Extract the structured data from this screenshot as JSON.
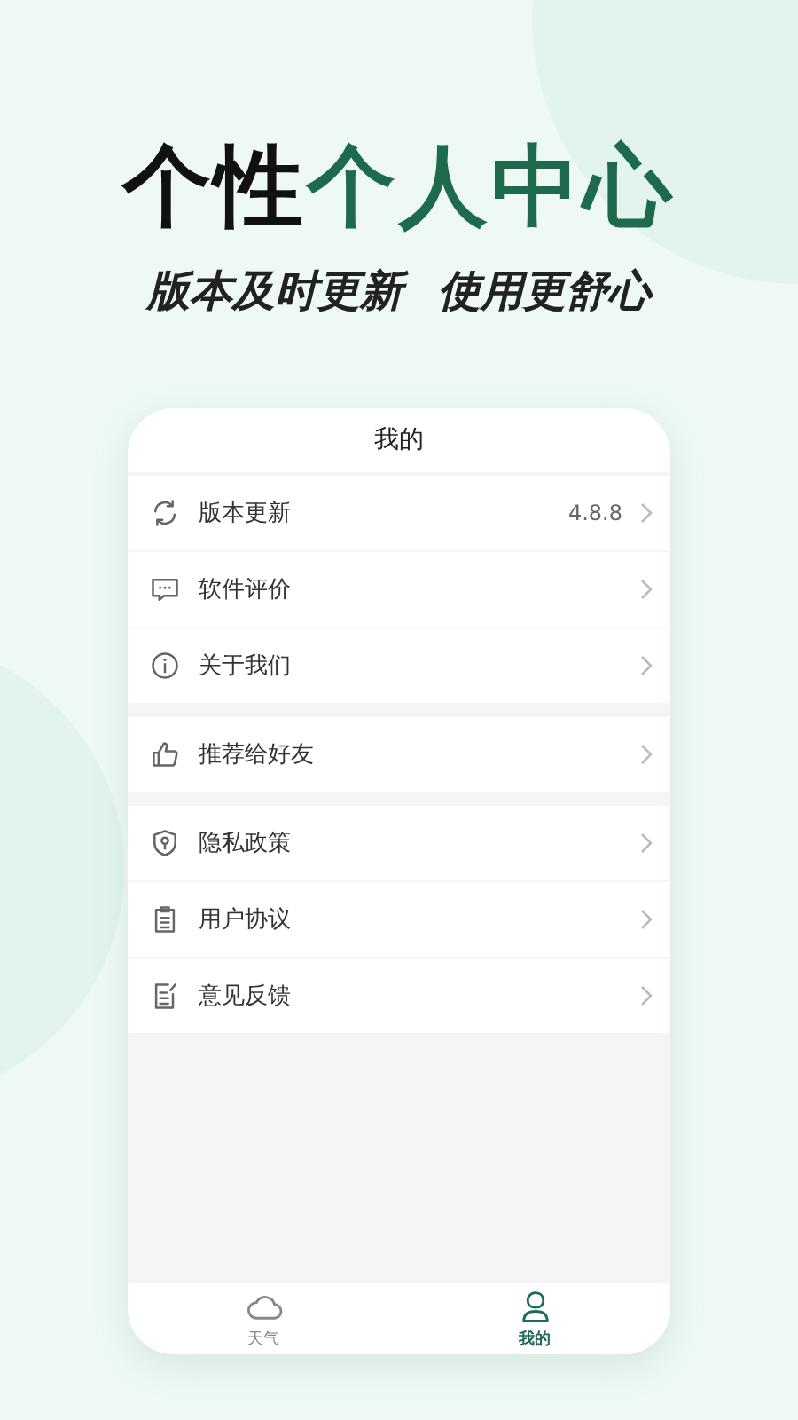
{
  "headline": {
    "dark": "个性",
    "accent": "个人中心"
  },
  "slogans": [
    "版本及时更新",
    "使用更舒心"
  ],
  "screen": {
    "title": "我的",
    "groups": [
      {
        "items": [
          {
            "label": "版本更新",
            "value": "4.8.8"
          },
          {
            "label": "软件评价"
          },
          {
            "label": "关于我们"
          }
        ]
      },
      {
        "items": [
          {
            "label": "推荐给好友"
          }
        ]
      },
      {
        "items": [
          {
            "label": "隐私政策"
          },
          {
            "label": "用户协议"
          },
          {
            "label": "意见反馈"
          }
        ]
      }
    ],
    "tabs": [
      {
        "label": "天气",
        "selected": false
      },
      {
        "label": "我的",
        "selected": true
      }
    ]
  }
}
